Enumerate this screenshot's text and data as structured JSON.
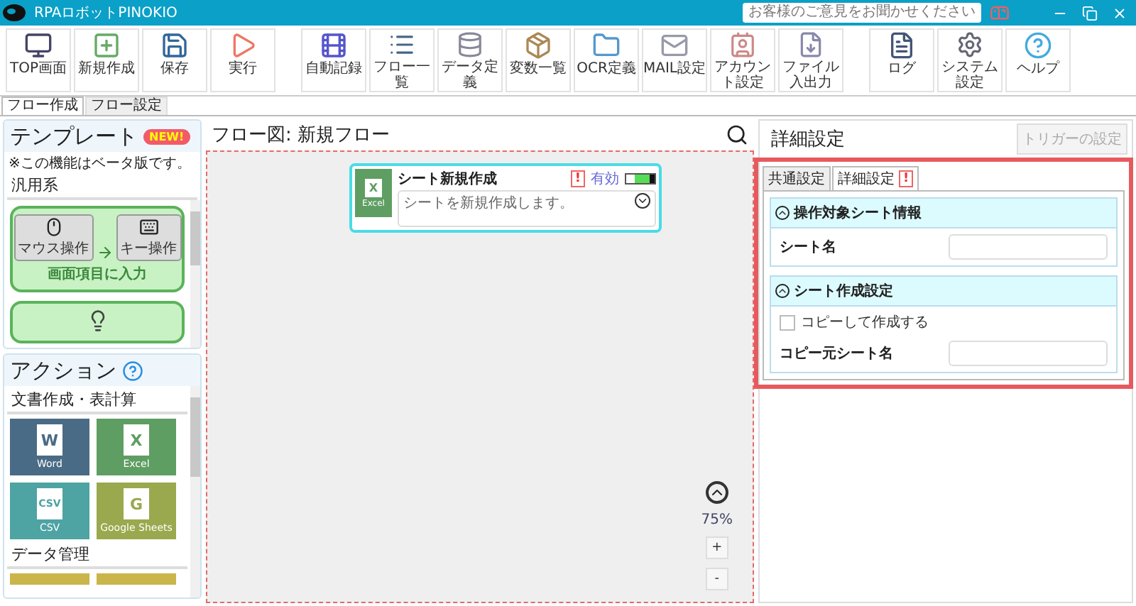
{
  "window": {
    "title": "RPAロボットPINOKIO",
    "feedback": "お客様のご意見をお聞かせください"
  },
  "toolbar_groups": [
    [
      {
        "kind": "top",
        "label": "TOP画面"
      },
      {
        "kind": "new",
        "label": "新規作成"
      },
      {
        "kind": "save",
        "label": "保存"
      },
      {
        "kind": "run",
        "label": "実行"
      }
    ],
    [
      {
        "kind": "record",
        "label": "自動記録"
      },
      {
        "kind": "flows",
        "label": "フロー一覧"
      },
      {
        "kind": "data",
        "label": "データ定義"
      },
      {
        "kind": "variables",
        "label": "変数一覧"
      },
      {
        "kind": "ocr",
        "label": "OCR定義"
      },
      {
        "kind": "mail",
        "label": "MAIL設定"
      },
      {
        "kind": "account",
        "label": "アカウント設定"
      },
      {
        "kind": "file",
        "label": "ファイル入出力"
      }
    ],
    [
      {
        "kind": "log",
        "label": "ログ"
      },
      {
        "kind": "system",
        "label": "システム設定"
      },
      {
        "kind": "help",
        "label": "ヘルプ"
      }
    ]
  ],
  "tabs": [
    {
      "label": "フロー作成",
      "selected": true
    },
    {
      "label": "フロー設定",
      "selected": false
    }
  ],
  "template": {
    "title": "テンプレート",
    "badge": "NEW!",
    "note": "※この機能はベータ版です。",
    "category": "汎用系",
    "cards": [
      {
        "kind": "full",
        "label": "画面項目に入力",
        "steps": [
          "マウス操作",
          "キー操作"
        ]
      },
      {
        "kind": "partial"
      }
    ]
  },
  "actions": {
    "title": "アクション",
    "categories": [
      {
        "name": "文書作成・表計算",
        "tiles": [
          {
            "letter": "W",
            "label": "Word",
            "color": "#4a6b85"
          },
          {
            "letter": "X",
            "label": "Excel",
            "color": "#5e9e62"
          },
          {
            "letter": "CSV",
            "label": "CSV",
            "color": "#4ea3a3"
          },
          {
            "letter": "G",
            "label": "Google Sheets",
            "color": "#9aa84e"
          }
        ]
      },
      {
        "name": "データ管理",
        "tiles": [
          {
            "color": "#c9b54a"
          },
          {
            "color": "#c9b54a"
          }
        ]
      }
    ]
  },
  "flow": {
    "title": "フロー図: 新規フロー",
    "nodes": [
      {
        "title": "シート新規作成",
        "description": "シートを新規作成します。",
        "app": "Excel",
        "app_letter": "X",
        "warning": "!",
        "enabled_label": "有効",
        "enabled": true,
        "selected": true
      }
    ],
    "zoom": {
      "reading": "75%",
      "zoom_in": "+",
      "zoom_out": "-"
    }
  },
  "details": {
    "title": "詳細設定",
    "highlighted": true,
    "trigger_button": {
      "label": "トリガーの設定",
      "disabled": true
    },
    "tabs": [
      {
        "label": "共通設定",
        "selected": false
      },
      {
        "label": "詳細設定",
        "selected": true,
        "warning": "!"
      }
    ],
    "sections": [
      {
        "title": "操作対象シート情報",
        "expanded": true,
        "rows": [
          {
            "kind": "field",
            "label": "シート名"
          }
        ]
      },
      {
        "title": "シート作成設定",
        "expanded": true,
        "rows": [
          {
            "kind": "checkbox",
            "label": "コピーして作成する",
            "checked": false
          },
          {
            "kind": "field",
            "label": "コピー元シート名"
          }
        ]
      }
    ]
  }
}
